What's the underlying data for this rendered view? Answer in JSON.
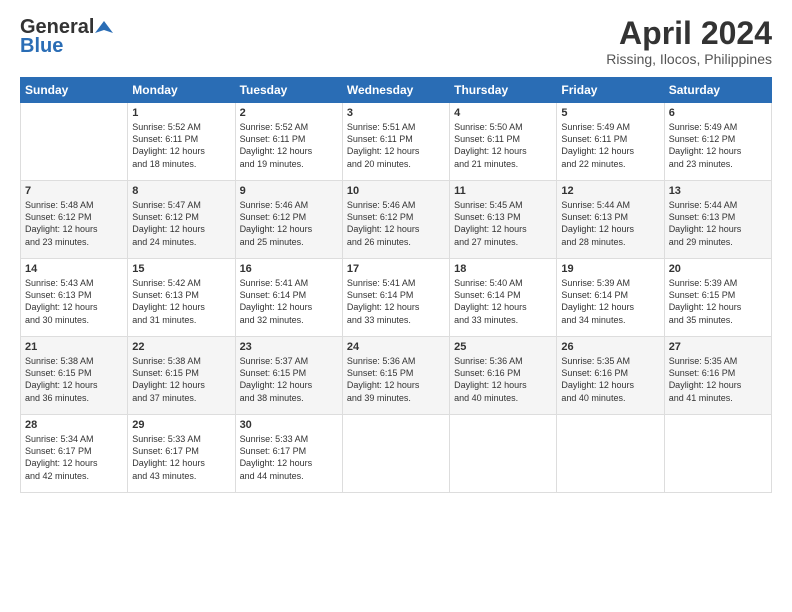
{
  "header": {
    "logo_general": "General",
    "logo_blue": "Blue",
    "title": "April 2024",
    "location": "Rissing, Ilocos, Philippines"
  },
  "days_of_week": [
    "Sunday",
    "Monday",
    "Tuesday",
    "Wednesday",
    "Thursday",
    "Friday",
    "Saturday"
  ],
  "weeks": [
    [
      {
        "day": "",
        "content": ""
      },
      {
        "day": "1",
        "content": "Sunrise: 5:52 AM\nSunset: 6:11 PM\nDaylight: 12 hours\nand 18 minutes."
      },
      {
        "day": "2",
        "content": "Sunrise: 5:52 AM\nSunset: 6:11 PM\nDaylight: 12 hours\nand 19 minutes."
      },
      {
        "day": "3",
        "content": "Sunrise: 5:51 AM\nSunset: 6:11 PM\nDaylight: 12 hours\nand 20 minutes."
      },
      {
        "day": "4",
        "content": "Sunrise: 5:50 AM\nSunset: 6:11 PM\nDaylight: 12 hours\nand 21 minutes."
      },
      {
        "day": "5",
        "content": "Sunrise: 5:49 AM\nSunset: 6:11 PM\nDaylight: 12 hours\nand 22 minutes."
      },
      {
        "day": "6",
        "content": "Sunrise: 5:49 AM\nSunset: 6:12 PM\nDaylight: 12 hours\nand 23 minutes."
      }
    ],
    [
      {
        "day": "7",
        "content": "Sunrise: 5:48 AM\nSunset: 6:12 PM\nDaylight: 12 hours\nand 23 minutes."
      },
      {
        "day": "8",
        "content": "Sunrise: 5:47 AM\nSunset: 6:12 PM\nDaylight: 12 hours\nand 24 minutes."
      },
      {
        "day": "9",
        "content": "Sunrise: 5:46 AM\nSunset: 6:12 PM\nDaylight: 12 hours\nand 25 minutes."
      },
      {
        "day": "10",
        "content": "Sunrise: 5:46 AM\nSunset: 6:12 PM\nDaylight: 12 hours\nand 26 minutes."
      },
      {
        "day": "11",
        "content": "Sunrise: 5:45 AM\nSunset: 6:13 PM\nDaylight: 12 hours\nand 27 minutes."
      },
      {
        "day": "12",
        "content": "Sunrise: 5:44 AM\nSunset: 6:13 PM\nDaylight: 12 hours\nand 28 minutes."
      },
      {
        "day": "13",
        "content": "Sunrise: 5:44 AM\nSunset: 6:13 PM\nDaylight: 12 hours\nand 29 minutes."
      }
    ],
    [
      {
        "day": "14",
        "content": "Sunrise: 5:43 AM\nSunset: 6:13 PM\nDaylight: 12 hours\nand 30 minutes."
      },
      {
        "day": "15",
        "content": "Sunrise: 5:42 AM\nSunset: 6:13 PM\nDaylight: 12 hours\nand 31 minutes."
      },
      {
        "day": "16",
        "content": "Sunrise: 5:41 AM\nSunset: 6:14 PM\nDaylight: 12 hours\nand 32 minutes."
      },
      {
        "day": "17",
        "content": "Sunrise: 5:41 AM\nSunset: 6:14 PM\nDaylight: 12 hours\nand 33 minutes."
      },
      {
        "day": "18",
        "content": "Sunrise: 5:40 AM\nSunset: 6:14 PM\nDaylight: 12 hours\nand 33 minutes."
      },
      {
        "day": "19",
        "content": "Sunrise: 5:39 AM\nSunset: 6:14 PM\nDaylight: 12 hours\nand 34 minutes."
      },
      {
        "day": "20",
        "content": "Sunrise: 5:39 AM\nSunset: 6:15 PM\nDaylight: 12 hours\nand 35 minutes."
      }
    ],
    [
      {
        "day": "21",
        "content": "Sunrise: 5:38 AM\nSunset: 6:15 PM\nDaylight: 12 hours\nand 36 minutes."
      },
      {
        "day": "22",
        "content": "Sunrise: 5:38 AM\nSunset: 6:15 PM\nDaylight: 12 hours\nand 37 minutes."
      },
      {
        "day": "23",
        "content": "Sunrise: 5:37 AM\nSunset: 6:15 PM\nDaylight: 12 hours\nand 38 minutes."
      },
      {
        "day": "24",
        "content": "Sunrise: 5:36 AM\nSunset: 6:15 PM\nDaylight: 12 hours\nand 39 minutes."
      },
      {
        "day": "25",
        "content": "Sunrise: 5:36 AM\nSunset: 6:16 PM\nDaylight: 12 hours\nand 40 minutes."
      },
      {
        "day": "26",
        "content": "Sunrise: 5:35 AM\nSunset: 6:16 PM\nDaylight: 12 hours\nand 40 minutes."
      },
      {
        "day": "27",
        "content": "Sunrise: 5:35 AM\nSunset: 6:16 PM\nDaylight: 12 hours\nand 41 minutes."
      }
    ],
    [
      {
        "day": "28",
        "content": "Sunrise: 5:34 AM\nSunset: 6:17 PM\nDaylight: 12 hours\nand 42 minutes."
      },
      {
        "day": "29",
        "content": "Sunrise: 5:33 AM\nSunset: 6:17 PM\nDaylight: 12 hours\nand 43 minutes."
      },
      {
        "day": "30",
        "content": "Sunrise: 5:33 AM\nSunset: 6:17 PM\nDaylight: 12 hours\nand 44 minutes."
      },
      {
        "day": "",
        "content": ""
      },
      {
        "day": "",
        "content": ""
      },
      {
        "day": "",
        "content": ""
      },
      {
        "day": "",
        "content": ""
      }
    ]
  ]
}
